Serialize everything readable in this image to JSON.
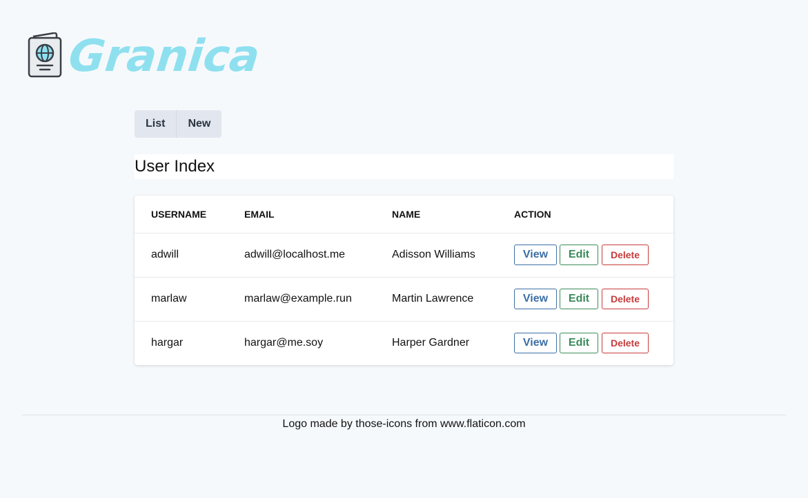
{
  "brand": {
    "name": "Granica",
    "color": "#8fe0ef",
    "icon": "passport-icon"
  },
  "tabs": [
    {
      "label": "List"
    },
    {
      "label": "New"
    }
  ],
  "page": {
    "title": "User Index"
  },
  "table": {
    "headers": [
      "USERNAME",
      "EMAIL",
      "NAME",
      "ACTION"
    ],
    "rows": [
      {
        "username": "adwill",
        "email": "adwill@localhost.me",
        "name": "Adisson Williams"
      },
      {
        "username": "marlaw",
        "email": "marlaw@example.run",
        "name": "Martin Lawrence"
      },
      {
        "username": "hargar",
        "email": "hargar@me.soy",
        "name": "Harper Gardner"
      }
    ],
    "actions": {
      "view": "View",
      "edit": "Edit",
      "delete": "Delete"
    }
  },
  "footer": {
    "text": "Logo made by those-icons from www.flaticon.com"
  },
  "colors": {
    "view": "#3b6ea5",
    "edit": "#3a8a5a",
    "delete": "#c73a3a"
  }
}
